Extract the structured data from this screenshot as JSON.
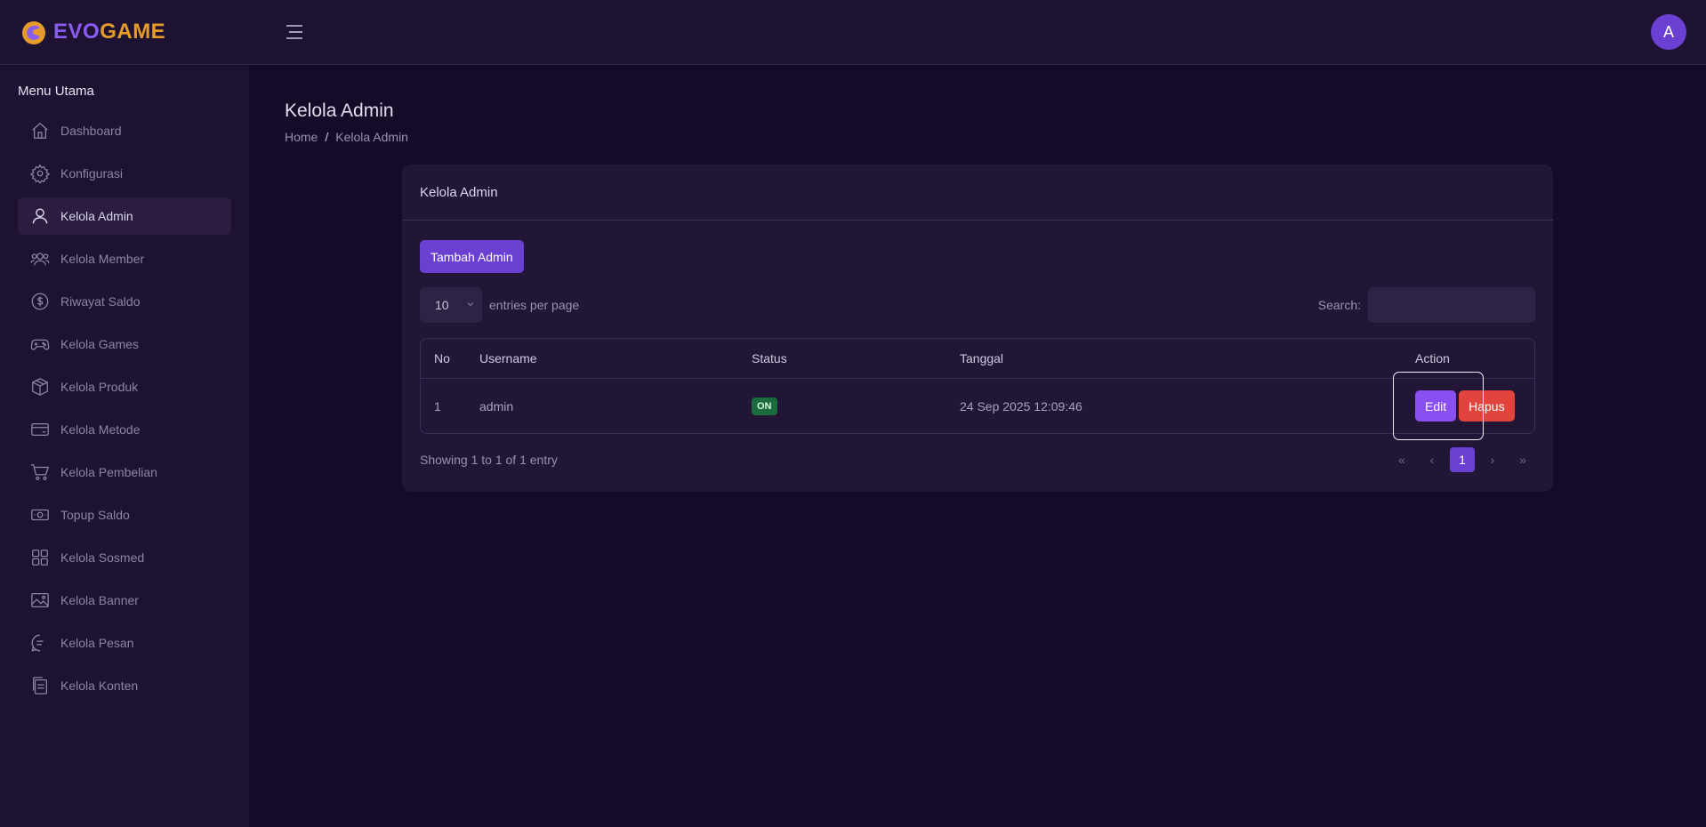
{
  "brand": {
    "logo_text_part1": "EVO",
    "logo_text_part2": "GAME",
    "colors": {
      "accent": "#6a3fd1",
      "brand_orange": "#e49b2a"
    }
  },
  "header": {
    "avatar_initial": "A"
  },
  "sidebar": {
    "title": "Menu Utama",
    "items": [
      {
        "label": "Dashboard",
        "icon": "home-icon"
      },
      {
        "label": "Konfigurasi",
        "icon": "gear-icon"
      },
      {
        "label": "Kelola Admin",
        "icon": "user-icon",
        "active": true
      },
      {
        "label": "Kelola Member",
        "icon": "users-icon"
      },
      {
        "label": "Riwayat Saldo",
        "icon": "dollar-circle-icon"
      },
      {
        "label": "Kelola Games",
        "icon": "gamepad-icon"
      },
      {
        "label": "Kelola Produk",
        "icon": "box-icon"
      },
      {
        "label": "Kelola Metode",
        "icon": "credit-card-icon"
      },
      {
        "label": "Kelola Pembelian",
        "icon": "cart-icon"
      },
      {
        "label": "Topup Saldo",
        "icon": "banknote-icon"
      },
      {
        "label": "Kelola Sosmed",
        "icon": "grid-icon"
      },
      {
        "label": "Kelola Banner",
        "icon": "image-icon"
      },
      {
        "label": "Kelola Pesan",
        "icon": "chat-icon"
      },
      {
        "label": "Kelola Konten",
        "icon": "document-icon"
      }
    ]
  },
  "page": {
    "title": "Kelola Admin",
    "breadcrumb": {
      "home": "Home",
      "separator": "/",
      "current": "Kelola Admin"
    }
  },
  "card": {
    "title": "Kelola Admin",
    "add_button": "Tambah Admin",
    "entries_value": "10",
    "entries_label": "entries per page",
    "search_label": "Search:",
    "search_value": "",
    "columns": [
      "No",
      "Username",
      "Status",
      "Tanggal",
      "Action"
    ],
    "rows": [
      {
        "no": "1",
        "username": "admin",
        "status": "ON",
        "tanggal": "24 Sep 2025 12:09:46",
        "edit": "Edit",
        "delete": "Hapus"
      }
    ],
    "info": "Showing 1 to 1 of 1 entry",
    "pagination": {
      "first": "«",
      "prev": "‹",
      "current": "1",
      "next": "›",
      "last": "»"
    }
  }
}
